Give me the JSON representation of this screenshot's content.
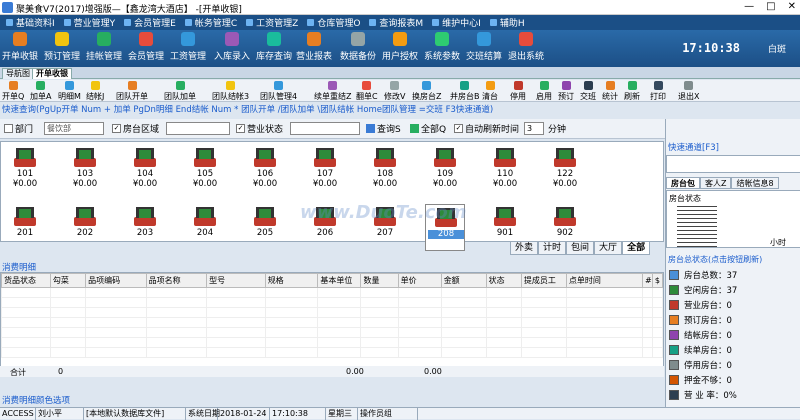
{
  "window": {
    "title": "聚美食V7(2017)增强版—【鑫龙湾大酒店】 -[开单收银]",
    "min": "—",
    "max": "□",
    "close": "✕"
  },
  "menu": [
    "基础资料I",
    "营业管理Y",
    "会员管理E",
    "帐务管理C",
    "工资管理Z",
    "仓库管理O",
    "查询报表M",
    "维护中心I",
    "辅助H"
  ],
  "toolbar1": [
    {
      "label": "开单收银",
      "color": "#e67e22"
    },
    {
      "label": "预订管理",
      "color": "#f1c40f"
    },
    {
      "label": "挂帐管理",
      "color": "#27ae60"
    },
    {
      "label": "会员管理",
      "color": "#e74c3c"
    },
    {
      "label": "工资管理",
      "color": "#3498db"
    },
    {
      "label": "入库录入",
      "color": "#9b59b6"
    },
    {
      "label": "库存查询",
      "color": "#1abc9c"
    },
    {
      "label": "营业报表",
      "color": "#e67e22"
    },
    {
      "label": "数据备份",
      "color": "#95a5a6"
    },
    {
      "label": "用户授权",
      "color": "#f39c12"
    },
    {
      "label": "系统参数",
      "color": "#2ecc71"
    },
    {
      "label": "交班结算",
      "color": "#3498db"
    },
    {
      "label": "退出系统",
      "color": "#e74c3c"
    }
  ],
  "clock": "17:10:38",
  "weather": "白斑",
  "tabs": [
    "导航图",
    "开单收银"
  ],
  "toolbar2": [
    "开单Q",
    "加单A",
    "明细M",
    "结帐J",
    "团队开单",
    "团队加单",
    "团队结帐3",
    "团队管理4",
    "续单重结Z",
    "翻单C",
    "修改V",
    "换房台Z",
    "并房台B",
    "清台",
    "停用",
    "启用",
    "预订",
    "交班",
    "统计",
    "刷新",
    "打印",
    "退出X"
  ],
  "hint": "快速查询(PgUp开单 Num + 加单 PgDn明细 End结帐 Num * 团队开单 /团队加单 \\团队结帐 Home团队管理 =交班 F3快速通道)",
  "filter": {
    "dept_label": "部门",
    "dept_value": "餐饮部",
    "area_label": "房台区域",
    "status_label": "营业状态",
    "query": "查询S",
    "all": "全部Q",
    "autorefresh": "自动刷新时间",
    "interval": "3",
    "unit": "分钟"
  },
  "rooms_row1": [
    {
      "num": "101",
      "price": "¥0.00"
    },
    {
      "num": "103",
      "price": "¥0.00"
    },
    {
      "num": "104",
      "price": "¥0.00"
    },
    {
      "num": "105",
      "price": "¥0.00"
    },
    {
      "num": "106",
      "price": "¥0.00"
    },
    {
      "num": "107",
      "price": "¥0.00"
    },
    {
      "num": "108",
      "price": "¥0.00"
    },
    {
      "num": "109",
      "price": "¥0.00"
    },
    {
      "num": "110",
      "price": "¥0.00"
    },
    {
      "num": "122",
      "price": "¥0.00"
    }
  ],
  "rooms_row2": [
    {
      "num": "201"
    },
    {
      "num": "202"
    },
    {
      "num": "203"
    },
    {
      "num": "204"
    },
    {
      "num": "205"
    },
    {
      "num": "206"
    },
    {
      "num": "207"
    },
    {
      "num": "208"
    },
    {
      "num": "901"
    },
    {
      "num": "902"
    }
  ],
  "view_tabs": [
    "外卖",
    "计时",
    "包间",
    "大厅",
    "全部"
  ],
  "consume_title": "消费明细",
  "consume_cols": [
    "货品状态",
    "勾菜",
    "品项编码",
    "品项名称",
    "型号",
    "规格",
    "基本单位",
    "数量",
    "单价",
    "金额",
    "状态",
    "提成员工",
    "点单时间",
    "#",
    "$"
  ],
  "total": {
    "label": "合计",
    "qty": "0",
    "amount": "0.00",
    "money": "0.00"
  },
  "detail_color": "消费明细颜色选项",
  "statusbar": [
    "ACCESS",
    "刘小平",
    "[本地默认数据库文件]",
    "系统日期",
    "2018-01-24",
    "17:10:38",
    "星期三",
    "操作员组"
  ],
  "right": {
    "fast_title": "快速通道[F3]",
    "tabs": [
      "房台包",
      "客人Z",
      "结帐信息8"
    ],
    "room_status_label": "房台状态",
    "hours": "小时",
    "summary_title": "房台总状态(点击按钮刷新)",
    "legend": [
      {
        "label": "房台总数：37",
        "color": "#4a90d9"
      },
      {
        "label": "空闲房台：37",
        "color": "#2e8b3a"
      },
      {
        "label": "营业房台：0",
        "color": "#c0392b"
      },
      {
        "label": "预订房台：0",
        "color": "#e67e22"
      },
      {
        "label": "结帐房台：0",
        "color": "#8e44ad"
      },
      {
        "label": "续单房台：0",
        "color": "#16a085"
      },
      {
        "label": "停用房台：0",
        "color": "#7f8c8d"
      },
      {
        "label": "押金不够：0",
        "color": "#d35400"
      },
      {
        "label": "营 业 率：0%",
        "color": "#2c3e50"
      }
    ]
  }
}
